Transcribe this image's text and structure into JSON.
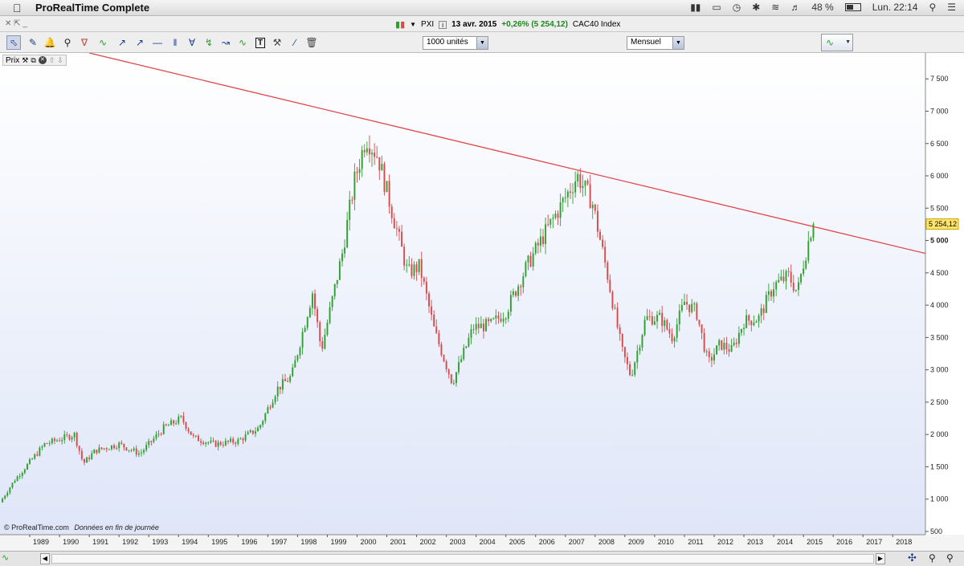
{
  "menubar": {
    "app_name": "ProRealTime Complete",
    "battery": "48 %",
    "clock": "Lun. 22:14"
  },
  "infobar": {
    "symbol": "PXI",
    "date": "13 avr. 2015",
    "change": "+0,26% (5 254,12)",
    "index_name": "CAC40 Index",
    "change_color": "#1a8a1a"
  },
  "toolbar": {
    "units_select": "1000 unités",
    "period_select": "Mensuel"
  },
  "panel": {
    "label": "Prix",
    "copyright": "© ProRealTime.com",
    "data_note": "Données en fin de journée"
  },
  "chart_data": {
    "type": "candlestick",
    "yticks": [
      500,
      1000,
      1500,
      2000,
      2500,
      3000,
      3500,
      4000,
      4500,
      5000,
      5500,
      6000,
      6500,
      7000,
      7500
    ],
    "ylim": [
      450,
      7900
    ],
    "xlim": [
      1988.0,
      2019.1
    ],
    "x_tick_labels": [
      "1989",
      "1990",
      "1991",
      "1992",
      "1993",
      "1994",
      "1995",
      "1996",
      "1997",
      "1998",
      "1999",
      "2000",
      "2001",
      "2002",
      "2003",
      "2004",
      "2005",
      "2006",
      "2007",
      "2008",
      "2009",
      "2010",
      "2011",
      "2012",
      "2013",
      "2014",
      "2015",
      "2016",
      "2017",
      "2018"
    ],
    "last_price": "5 254,12",
    "last_price_value": 5254,
    "trendline": {
      "x": [
        1991.0,
        2019.1
      ],
      "y": [
        7900,
        4800
      ],
      "color": "#e0474c"
    },
    "up_color": "#2fa02f",
    "down_color": "#d94a4a",
    "price_keypoints": {
      "t": [
        1988.0,
        1988.5,
        1989.5,
        1990.5,
        1990.8,
        1991.2,
        1992.0,
        1992.7,
        1993.5,
        1994.1,
        1994.5,
        1995.2,
        1996.0,
        1996.7,
        1997.3,
        1997.8,
        1998.5,
        1998.8,
        1999.5,
        1999.9,
        2000.3,
        2000.7,
        2001.2,
        2001.7,
        2002.1,
        2002.6,
        2003.2,
        2003.9,
        2004.5,
        2005.0,
        2005.7,
        2006.3,
        2006.8,
        2007.4,
        2007.9,
        2008.4,
        2008.9,
        2009.2,
        2009.7,
        2010.2,
        2010.6,
        2011.0,
        2011.4,
        2011.8,
        2012.2,
        2012.6,
        2013.0,
        2013.5,
        2014.0,
        2014.5,
        2014.8,
        2015.0,
        2015.3
      ],
      "c": [
        950,
        1300,
        1850,
        2000,
        1550,
        1750,
        1850,
        1700,
        2100,
        2250,
        1950,
        1850,
        1900,
        2100,
        2700,
        2900,
        4200,
        3300,
        4800,
        5900,
        6600,
        6300,
        5400,
        4500,
        4600,
        3600,
        2800,
        3650,
        3700,
        3900,
        4600,
        5100,
        5500,
        6000,
        5600,
        4500,
        3300,
        2900,
        3800,
        3800,
        3500,
        4050,
        3900,
        3100,
        3400,
        3300,
        3750,
        3800,
        4300,
        4450,
        4200,
        4650,
        5254
      ]
    }
  }
}
